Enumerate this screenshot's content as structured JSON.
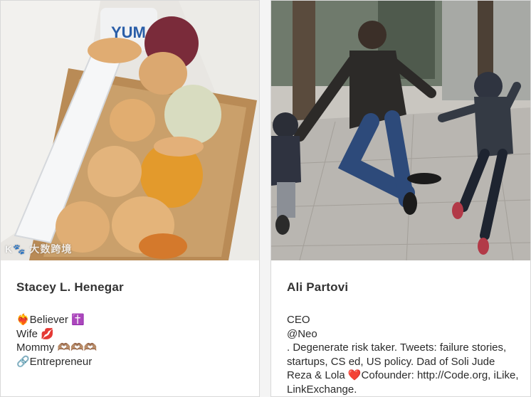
{
  "cards": [
    {
      "name": "Stacey L. Henegar",
      "bio_lines": [
        "❤️‍🔥Believer ✝️",
        "Wife 💋",
        "Mommy 🫶🏽🫶🏽🫶🏽",
        "🔗Entrepreneur"
      ],
      "photo_label": "Box of baby food jars and ice packs",
      "photo_jar_label": "YUM"
    },
    {
      "name": "Ali Partovi",
      "bio_lines": [
        "CEO",
        "@Neo"
      ],
      "bio_paragraph": ". Degenerate risk taker. Tweets: failure stories, startups, CS ed, US policy. Dad of Soli Jude Reza & Lola ❤️Cofounder: http://Code.org, iLike, LinkExchange.",
      "photo_label": "Man and child jump-kicking on a city sidewalk"
    }
  ],
  "watermark": "K🐾 大数跨境"
}
